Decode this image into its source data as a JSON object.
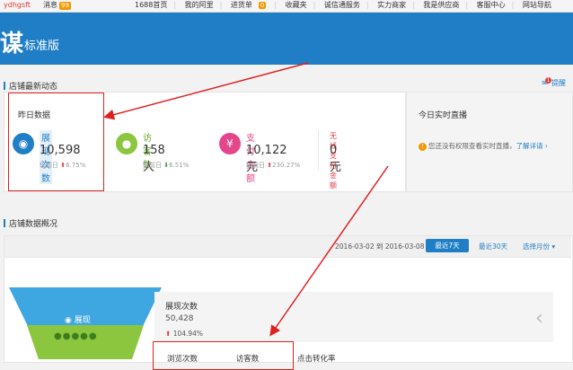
{
  "topbar": {
    "user": "ydhgsft",
    "messages_label": "消息",
    "messages_count": "99",
    "nav": [
      "1688首页",
      "我的阿里",
      "进货单",
      "收藏夹",
      "诚信通服务",
      "实力商家",
      "我是供应商",
      "客服中心",
      "网站导航"
    ],
    "cart_count": "0"
  },
  "header": {
    "big_char": "谋",
    "edition": "标准版"
  },
  "shop_dynamic": {
    "title": "店铺最新动态",
    "remind_label": "提醒",
    "remind_count": "1",
    "yesterday_label": "昨日数据",
    "metrics": [
      {
        "icon": "eye-icon",
        "name": "展现次数",
        "value": "10,598",
        "compare_label": "较前日",
        "trend": "up",
        "change": "6.75%",
        "color": "#1f7ec5"
      },
      {
        "icon": "user-icon",
        "name": "访客数",
        "value": "158人",
        "compare_label": "较前日",
        "trend": "down",
        "change": "6.51%",
        "color": "#8cc63f"
      },
      {
        "icon": "yen-icon",
        "name": "支付金额",
        "value": "10,122元",
        "compare_label": "较前日",
        "trend": "up",
        "change": "230.27%",
        "color": "#e5468b"
      },
      {
        "icon": "",
        "name": "无线支付金额",
        "value": "0元",
        "compare_label": "",
        "trend": "",
        "change": "-",
        "color": "#e4393c"
      }
    ],
    "live_title": "今日实时直播",
    "live_text": "您还没有权限查看实时直播，",
    "live_link": "了解详请"
  },
  "shop_overview": {
    "title": "店铺数据概况",
    "date_from": "2016-03-02",
    "date_to_label": "到",
    "date_to": "2016-03-08",
    "btn_7days": "最近7天",
    "btn_30days": "最近30天",
    "btn_month": "选择月份",
    "funnel_label": "展现",
    "detail_title": "展现次数",
    "detail_value": "50,428",
    "detail_pct": "104.94%",
    "bottom_items": [
      "浏览次数",
      "访客数",
      "点击转化率"
    ]
  },
  "colors": {
    "brand_blue": "#1f7ec5",
    "annotation_red": "#e02020"
  }
}
